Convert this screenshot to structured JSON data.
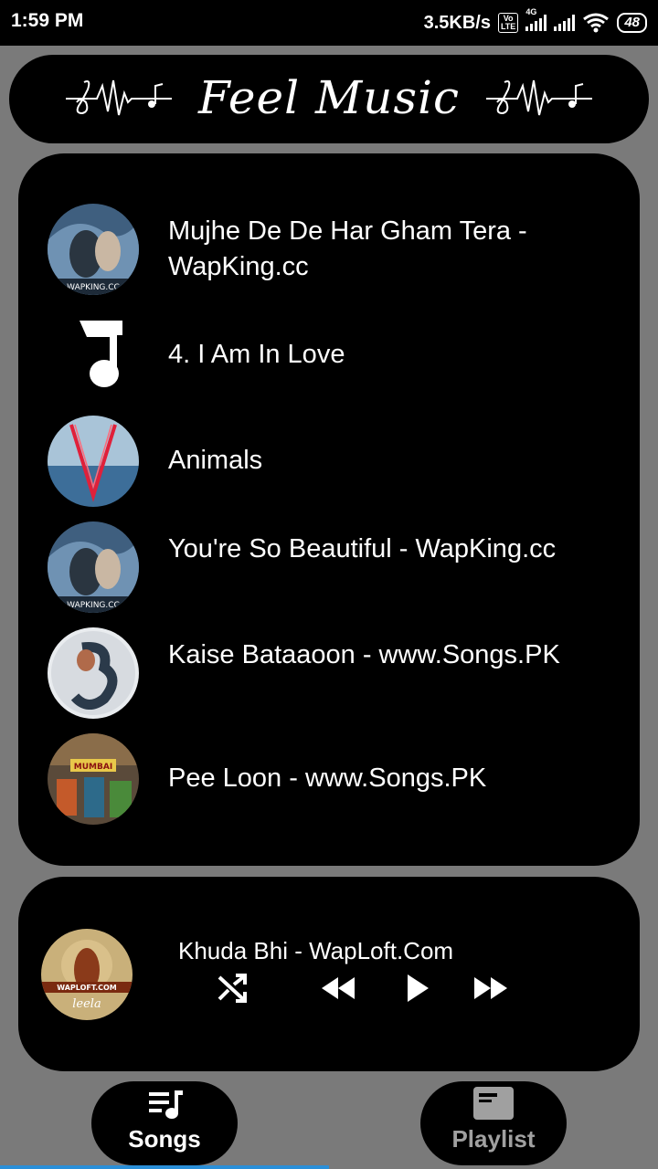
{
  "status_bar": {
    "time": "1:59 PM",
    "net_speed": "3.5KB/s",
    "volte_top": "Vo",
    "volte_bottom": "LTE",
    "network_type": "4G",
    "battery": "48"
  },
  "header": {
    "title": "Feel Music"
  },
  "songs": [
    {
      "title": "Mujhe De De Har Gham Tera - WapKing.cc",
      "art": "album-art-romantic",
      "art_caption": "WAPKING.CC"
    },
    {
      "title": "4. I Am In Love",
      "art": "music-note-icon"
    },
    {
      "title": "Animals",
      "art": "album-art-v"
    },
    {
      "title": "You're So Beautiful - WapKing.cc",
      "art": "album-art-romantic",
      "art_caption": "WAPKING.CC"
    },
    {
      "title": "Kaise Bataaoon - www.Songs.PK",
      "art": "album-art-3"
    },
    {
      "title": "Pee Loon - www.Songs.PK",
      "art": "album-art-mumbai",
      "art_caption": "MUMBAI"
    }
  ],
  "now_playing": {
    "title": "Khuda Bhi - WapLoft.Com",
    "art_caption_top": "WAPLOFT.COM",
    "art_caption_bottom": "leela"
  },
  "controls": [
    "shuffle-icon",
    "rewind-icon",
    "play-icon",
    "fast-forward-icon"
  ],
  "tabs": [
    {
      "label": "Songs",
      "icon": "songs-list-icon",
      "active": true
    },
    {
      "label": "Playlist",
      "icon": "playlist-icon",
      "active": false
    }
  ],
  "colors": {
    "background": "#7a7a7a",
    "card": "#000000",
    "text": "#ffffff",
    "inactive_tab_text": "#a0a0a0",
    "progress_accent": "#2a8fd8"
  }
}
